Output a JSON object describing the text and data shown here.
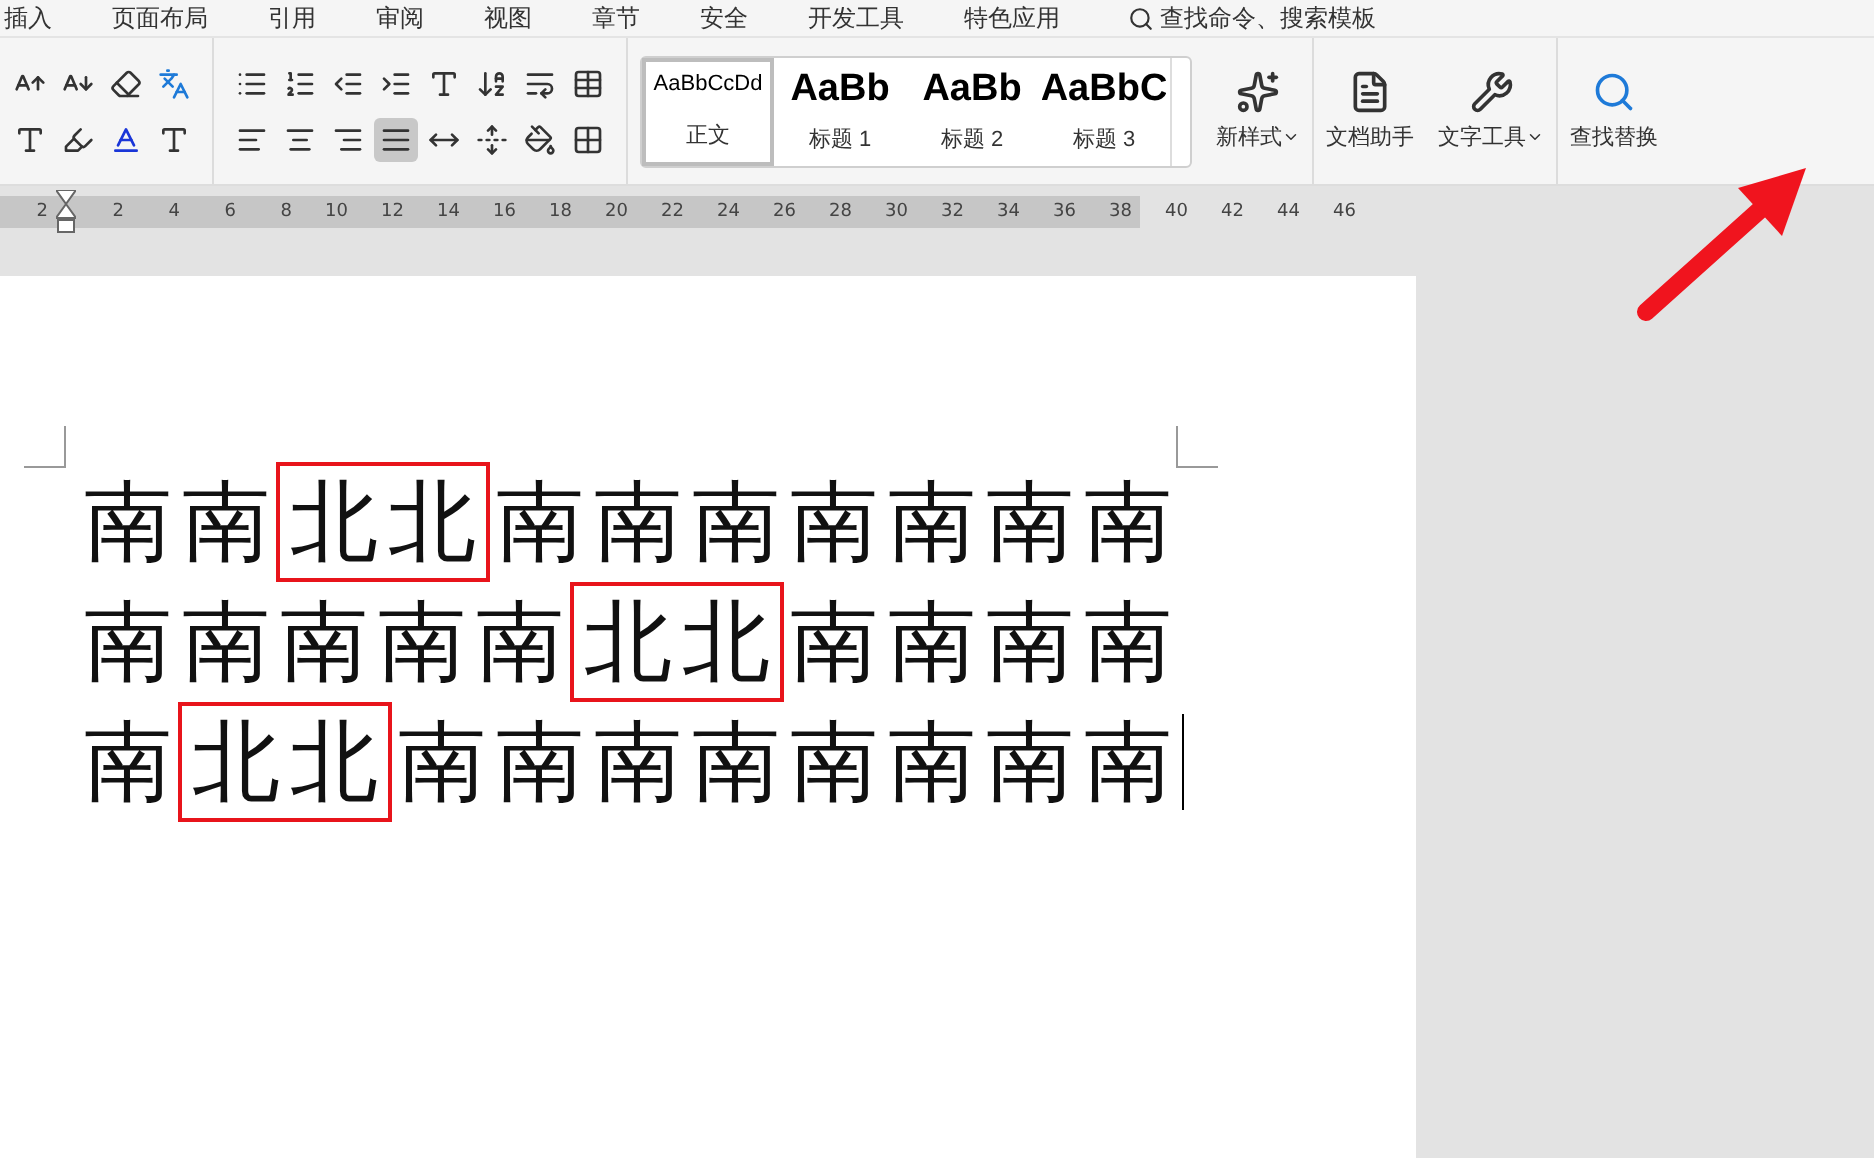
{
  "menu": [
    {
      "label": "插入"
    },
    {
      "label": "页面布局"
    },
    {
      "label": "引用"
    },
    {
      "label": "审阅"
    },
    {
      "label": "视图"
    },
    {
      "label": "章节"
    },
    {
      "label": "安全"
    },
    {
      "label": "开发工具"
    },
    {
      "label": "特色应用"
    }
  ],
  "search": {
    "placeholder": "查找命令、搜索模板"
  },
  "alignment": [
    {
      "kind": "left",
      "selected": false
    },
    {
      "kind": "center",
      "selected": false
    },
    {
      "kind": "right",
      "selected": false
    },
    {
      "kind": "justify",
      "selected": true
    },
    {
      "kind": "distribute",
      "selected": false
    }
  ],
  "styles": [
    {
      "sample": "AaBbCcDd",
      "label": "正文",
      "selected": true
    },
    {
      "sample": "AaBb",
      "label": "标题 1",
      "selected": false
    },
    {
      "sample": "AaBb",
      "label": "标题 2",
      "selected": false
    },
    {
      "sample": "AaBbC",
      "label": "标题 3",
      "selected": false
    }
  ],
  "tools": [
    {
      "kind": "new-style",
      "label": "新样式",
      "dropdown": true
    },
    {
      "kind": "assistant",
      "label": "文档助手",
      "dropdown": false
    },
    {
      "kind": "text-tools",
      "label": "文字工具",
      "dropdown": true
    },
    {
      "kind": "find",
      "label": "查找替换",
      "dropdown": false
    }
  ],
  "ruler": {
    "lead": "2",
    "numbers": [
      "2",
      "4",
      "6",
      "8",
      "10",
      "12",
      "14",
      "16",
      "18",
      "20",
      "22",
      "24",
      "26",
      "28",
      "30",
      "32",
      "34",
      "36",
      "38"
    ],
    "trail": [
      "40",
      "42",
      "44",
      "46"
    ]
  },
  "document": {
    "lines": [
      [
        {
          "text": "南南",
          "highlighted": false
        },
        {
          "text": "北北",
          "highlighted": true
        },
        {
          "text": "南南南南南南南",
          "highlighted": false
        }
      ],
      [
        {
          "text": "南南南南南",
          "highlighted": false
        },
        {
          "text": "北北",
          "highlighted": true
        },
        {
          "text": "南南南南",
          "highlighted": false
        }
      ],
      [
        {
          "text": "南",
          "highlighted": false
        },
        {
          "text": "北北",
          "highlighted": true
        },
        {
          "text": "南南南南南南南南",
          "highlighted": false
        }
      ]
    ]
  }
}
